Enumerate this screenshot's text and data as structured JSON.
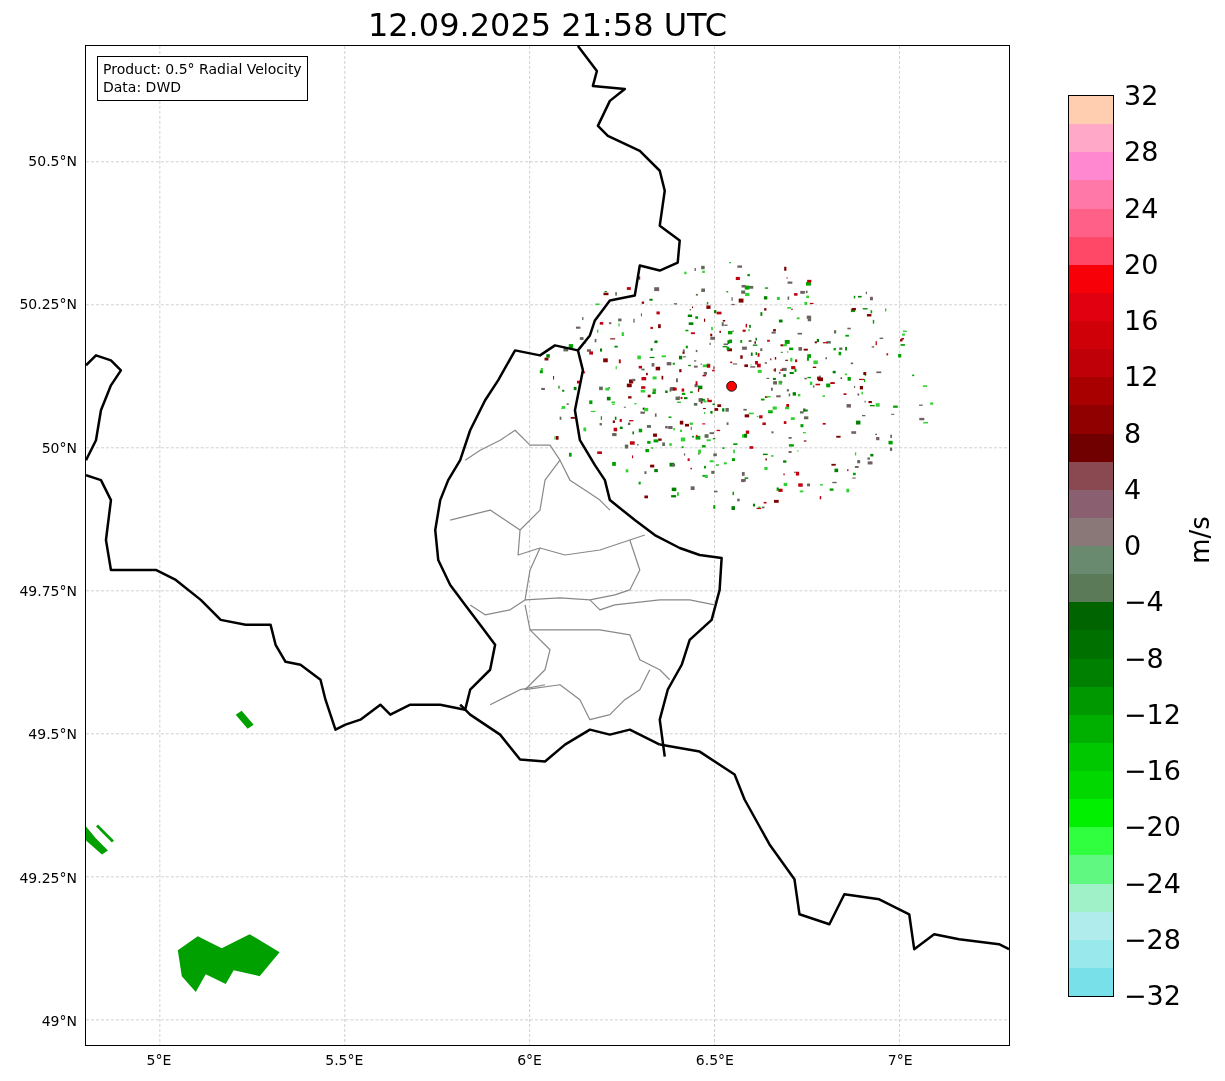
{
  "title": "12.09.2025 21:58 UTC",
  "legend": [
    "Product: 0.5° Radial Velocity",
    "Data: DWD"
  ],
  "y_ticks": [
    "50.5°N",
    "50.25°N",
    "50°N",
    "49.75°N",
    "49.5°N",
    "49.25°N",
    "49°N"
  ],
  "x_ticks": [
    "5°E",
    "5.5°E",
    "6°E",
    "6.5°E",
    "7°E"
  ],
  "colorbar": {
    "label": "m/s",
    "ticks": [
      "32",
      "28",
      "24",
      "20",
      "16",
      "12",
      "8",
      "4",
      "0",
      "−4",
      "−8",
      "−12",
      "−16",
      "−20",
      "−24",
      "−28",
      "−32"
    ],
    "segments": [
      {
        "color": "#ffcdb0"
      },
      {
        "color": "#ffa8c8"
      },
      {
        "color": "#ff88d0"
      },
      {
        "color": "#ff78a8"
      },
      {
        "color": "#ff6088"
      },
      {
        "color": "#ff4868"
      },
      {
        "color": "#f80008"
      },
      {
        "color": "#e00010"
      },
      {
        "color": "#d00008"
      },
      {
        "color": "#c00008"
      },
      {
        "color": "#a80000"
      },
      {
        "color": "#900000"
      },
      {
        "color": "#700000"
      },
      {
        "color": "#8a4850"
      },
      {
        "color": "#8a6070"
      },
      {
        "color": "#8a7878"
      },
      {
        "color": "#6a8a70"
      },
      {
        "color": "#5a7a58"
      },
      {
        "color": "#006400"
      },
      {
        "color": "#007000"
      },
      {
        "color": "#008000"
      },
      {
        "color": "#009800"
      },
      {
        "color": "#00b000"
      },
      {
        "color": "#00c800"
      },
      {
        "color": "#00d800"
      },
      {
        "color": "#00f000"
      },
      {
        "color": "#30ff40"
      },
      {
        "color": "#60f880"
      },
      {
        "color": "#a0f0c8"
      },
      {
        "color": "#b0ecec"
      },
      {
        "color": "#98e8ec"
      },
      {
        "color": "#78e0e8"
      }
    ]
  }
}
